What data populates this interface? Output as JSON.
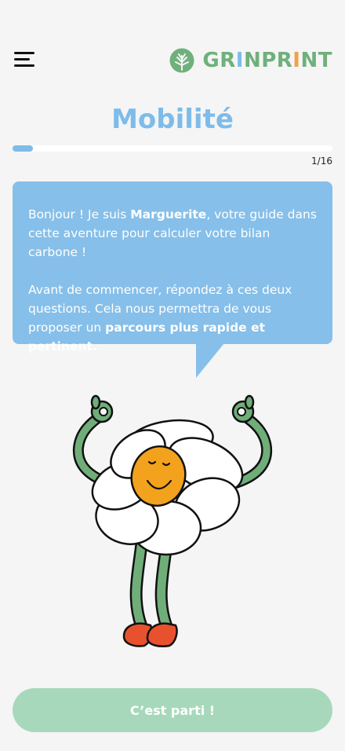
{
  "header": {
    "menu_icon": "hamburger-menu-icon",
    "logo": {
      "icon": "tree-icon",
      "text": "GRINPRINT",
      "letters": [
        {
          "char": "G",
          "color": "#6fb07c"
        },
        {
          "char": "R",
          "color": "#6fb07c"
        },
        {
          "char": "I",
          "color": "#7dbcea"
        },
        {
          "char": "N",
          "color": "#6fb07c"
        },
        {
          "char": "P",
          "color": "#6fb07c"
        },
        {
          "char": "R",
          "color": "#6fb07c"
        },
        {
          "char": "I",
          "color": "#f2a04a"
        },
        {
          "char": "N",
          "color": "#6fb07c"
        },
        {
          "char": "T",
          "color": "#6fb07c"
        }
      ]
    }
  },
  "page": {
    "title": "Mobilité"
  },
  "progress": {
    "current": 1,
    "total": 16,
    "label": "1/16",
    "fraction": 0.0625
  },
  "speech_bubble": {
    "p1_intro": "Bonjour ! Je suis ",
    "p1_name": "Marguerite",
    "p1_rest": ", votre guide dans cette aventure pour calculer votre bilan carbone !",
    "p2_intro": "Avant de commencer, répondez à ces deux questions. Cela nous permettra de vous proposer un ",
    "p2_bold": "parcours plus rapide et pertinent."
  },
  "mascot": {
    "icon": "daisy-mascot-icon"
  },
  "cta": {
    "label": "C’est parti !"
  },
  "colors": {
    "title": "#7dbcea",
    "bubble": "#86bfe9",
    "cta": "#a8d8bb",
    "brand_green": "#6fb07c",
    "brand_orange": "#f2a04a",
    "background": "#f5f5f5"
  }
}
